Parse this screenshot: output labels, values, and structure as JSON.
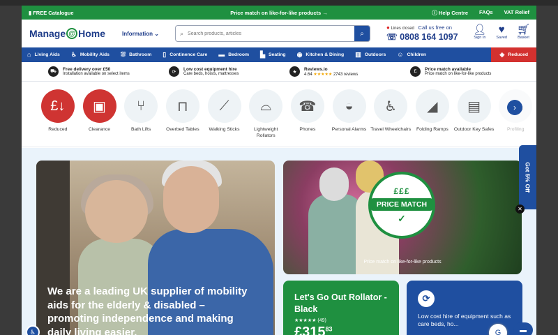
{
  "topbar": {
    "catalogue": "FREE Catalogue",
    "promo": "Price match on like-for-like products →",
    "help": "Help Centre",
    "faqs": "FAQs",
    "vat": "VAT Relief"
  },
  "header": {
    "logo_left": "Manage",
    "logo_right": "Home",
    "information": "Information",
    "search_placeholder": "Search products, articles",
    "lines_status": "Lines closed",
    "call_label": "Call us free on",
    "phone": "0808 164 1097",
    "icons": [
      {
        "label": "Sign In",
        "icon": "person-icon"
      },
      {
        "label": "Saved",
        "icon": "heart-icon"
      },
      {
        "label": "Basket",
        "icon": "basket-icon"
      }
    ]
  },
  "nav": [
    {
      "label": "Living Aids",
      "icon": "home-icon"
    },
    {
      "label": "Mobility Aids",
      "icon": "wheelchair-icon"
    },
    {
      "label": "Bathroom",
      "icon": "bath-icon"
    },
    {
      "label": "Continence Care",
      "icon": "continence-icon"
    },
    {
      "label": "Bedroom",
      "icon": "bed-icon"
    },
    {
      "label": "Seating",
      "icon": "chair-icon"
    },
    {
      "label": "Kitchen & Dining",
      "icon": "kitchen-icon"
    },
    {
      "label": "Outdoors",
      "icon": "outdoors-icon"
    },
    {
      "label": "Children",
      "icon": "children-icon"
    },
    {
      "label": "Reduced",
      "icon": "tag-icon"
    }
  ],
  "strip": [
    {
      "title": "Free delivery over £50",
      "sub": "Installation available on select items"
    },
    {
      "title": "Low cost equipment hire",
      "sub": "Care beds, hoists, mattresses"
    },
    {
      "title": "Reviews.io",
      "score": "4.64",
      "stars": "★★★★★",
      "sub": "2743 reviews"
    },
    {
      "title": "Price match available",
      "sub": "Price match on like-for-like products"
    }
  ],
  "categories": [
    "Reduced",
    "Clearance",
    "Bath Lifts",
    "Overbed Tables",
    "Walking Sticks",
    "Lightweight Rollators",
    "Phones",
    "Personal Alarms",
    "Travel Wheelchairs",
    "Folding Ramps",
    "Outdoor Key Safes",
    "Profiling"
  ],
  "hero": {
    "left_text": "We are a leading UK supplier of mobility aids for the elderly & disabled – promoting independence and making daily living easier.",
    "badge_top": "£££",
    "badge_main": "PRICE MATCH",
    "price_caption": "Price match on like-for-like products",
    "rollator_title": "Let's Go Out Rollator - Black",
    "rollator_stars": "★★★★★",
    "rollator_reviews": "(49)",
    "rollator_price": "£315",
    "rollator_pence": "83",
    "hire_text": "Low cost hire of equipment such as care beds, ho..."
  },
  "side_tab": "Get 5% Off"
}
